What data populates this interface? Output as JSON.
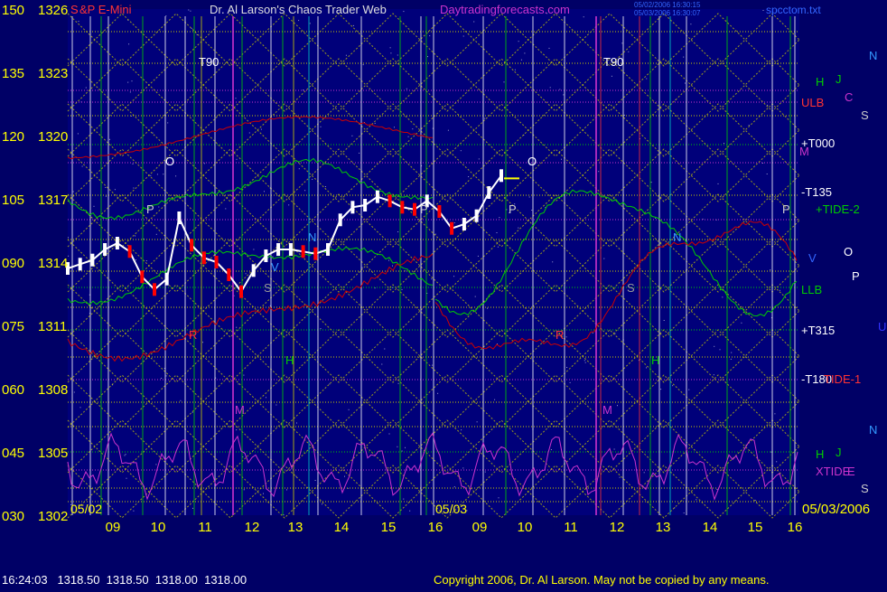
{
  "header": {
    "symbol_prefix": "S",
    "symbol": "&P E-Mini",
    "title": "Dr. Al Larson's Chaos Trader Web",
    "site": "Daytradingforecasts.com",
    "stamp1": "05/02/2006 16:30:15",
    "stamp2": "05/03/2006 16:30:07",
    "file": "spcctom.txt"
  },
  "colors": {
    "background": "#000066",
    "plot": "#00007a",
    "price_up": "#ffffff",
    "price_down": "#ff0000",
    "tide": "#00cc00",
    "xtide": "#cc33cc",
    "band": "#cc0000",
    "scale_text": "#ffff00",
    "grid_yellow": "#cccc00"
  },
  "chart_data": {
    "type": "line",
    "y_scale_left": [
      "150",
      "135",
      "120",
      "105",
      "090",
      "075",
      "060",
      "045",
      "030"
    ],
    "y_ticks": [
      1326,
      1323,
      1320,
      1317,
      1314,
      1311,
      1308,
      1305,
      1302
    ],
    "ylim": [
      1302,
      1326
    ],
    "x_ticks": [
      "09",
      "10",
      "11",
      "12",
      "13",
      "14",
      "15",
      "16",
      "09",
      "10",
      "11",
      "12",
      "13",
      "14",
      "15",
      "16"
    ],
    "dates": [
      "05/02",
      "05/03",
      "05/03/2006"
    ],
    "right_labels": [
      "ULB",
      "+T000",
      "-T135",
      "+TIDE-2",
      "LLB",
      "+T315",
      "-T180",
      "TIDE-1",
      "XTIDE"
    ],
    "planet_labels": [
      "N",
      "H",
      "J",
      "C",
      "S",
      "M",
      "O",
      "P",
      "V",
      "U",
      "N",
      "H",
      "J",
      "E",
      "S"
    ],
    "markers": [
      "T90",
      "T90",
      "O",
      "O",
      "P",
      "P",
      "P",
      "P",
      "N",
      "N",
      "S",
      "S",
      "H",
      "H",
      "M",
      "M",
      "R",
      "R",
      "V"
    ],
    "series": [
      {
        "name": "S&P E-Mini",
        "x": [
          0.0,
          0.2,
          0.4,
          0.6,
          0.8,
          1.0,
          1.2,
          1.4,
          1.6,
          1.8,
          2.0,
          2.2,
          2.4,
          2.6,
          2.8,
          3.0,
          3.2,
          3.4,
          3.6,
          3.8,
          4.0,
          4.2,
          4.4,
          4.6,
          4.8,
          5.0,
          5.2,
          5.4,
          5.6,
          5.8,
          6.0,
          6.2,
          6.4,
          6.6,
          6.8,
          7.0
        ],
        "values": [
          1313.7,
          1313.9,
          1314.1,
          1314.6,
          1314.9,
          1314.5,
          1313.3,
          1312.7,
          1313.2,
          1316.1,
          1314.8,
          1314.2,
          1314.0,
          1313.4,
          1312.6,
          1313.6,
          1314.3,
          1314.6,
          1314.6,
          1314.5,
          1314.4,
          1314.6,
          1316.0,
          1316.6,
          1316.7,
          1317.1,
          1316.9,
          1316.6,
          1316.5,
          1316.9,
          1316.4,
          1315.6,
          1315.8,
          1316.2,
          1317.3,
          1318.1
        ]
      }
    ]
  },
  "footer": {
    "quote": "16:24:03   1318.50  1318.50  1318.00  1318.00",
    "copyright": "Copyright 2006, Dr. Al Larson. May not be copied by any means."
  }
}
